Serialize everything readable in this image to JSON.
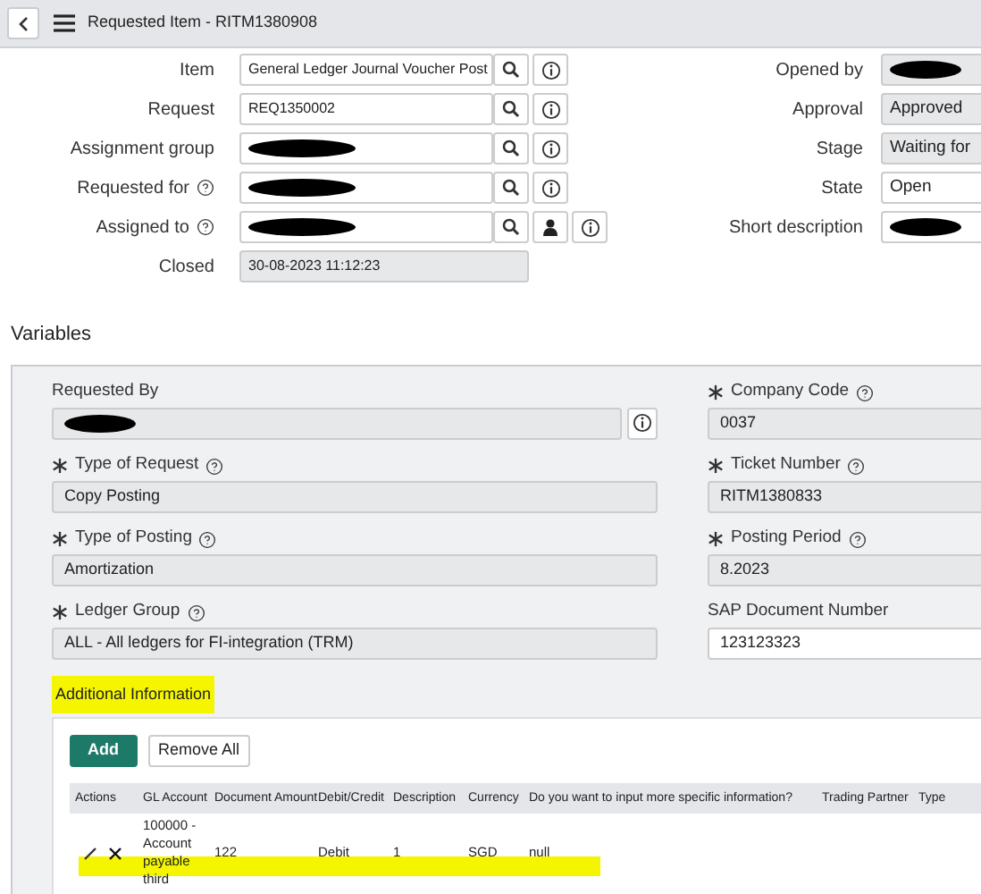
{
  "header": {
    "title": "Requested Item - RITM1380908"
  },
  "form_left": [
    {
      "label": "Item",
      "help": false,
      "value": "General Ledger Journal Voucher Post",
      "redacted": false,
      "readonly": false,
      "search": true,
      "person": false,
      "info": true
    },
    {
      "label": "Request",
      "help": false,
      "value": "REQ1350002",
      "redacted": false,
      "readonly": false,
      "search": true,
      "person": false,
      "info": true
    },
    {
      "label": "Assignment group",
      "help": false,
      "redacted": true,
      "readonly": false,
      "search": true,
      "person": false,
      "info": true
    },
    {
      "label": "Requested for",
      "help": true,
      "redacted": true,
      "readonly": false,
      "search": true,
      "person": false,
      "info": true
    },
    {
      "label": "Assigned to",
      "help": true,
      "redacted": true,
      "readonly": false,
      "search": true,
      "person": true,
      "info": true
    },
    {
      "label": "Closed",
      "help": false,
      "value": "30-08-2023 11:12:23",
      "redacted": false,
      "readonly": true,
      "search": false,
      "person": false,
      "info": false
    }
  ],
  "form_right": [
    {
      "label": "Opened by",
      "redacted": true,
      "readonly": true
    },
    {
      "label": "Approval",
      "value": "Approved",
      "redacted": false,
      "readonly": true
    },
    {
      "label": "Stage",
      "value": "Waiting for",
      "redacted": false,
      "readonly": true
    },
    {
      "label": "State",
      "value": "Open",
      "redacted": false,
      "readonly": false
    },
    {
      "label": "Short description",
      "redacted": true,
      "readonly": false
    }
  ],
  "variables": {
    "title": "Variables",
    "rows": [
      [
        {
          "label": "Requested By",
          "required": false,
          "help": false,
          "redacted": true,
          "readonly": true,
          "info": true
        },
        {
          "label": "Company Code",
          "required": true,
          "help": true,
          "value": "0037",
          "redacted": false,
          "readonly": true,
          "info": false
        }
      ],
      [
        {
          "label": "Type of Request",
          "required": true,
          "help": true,
          "value": "Copy Posting",
          "redacted": false,
          "readonly": true,
          "info": false
        },
        {
          "label": "Ticket Number",
          "required": true,
          "help": true,
          "value": "RITM1380833",
          "redacted": false,
          "readonly": true,
          "info": false
        }
      ],
      [
        {
          "label": "Type of Posting",
          "required": true,
          "help": true,
          "value": "Amortization",
          "redacted": false,
          "readonly": true,
          "info": false
        },
        {
          "label": "Posting Period",
          "required": true,
          "help": true,
          "value": "8.2023",
          "redacted": false,
          "readonly": true,
          "info": false
        }
      ],
      [
        {
          "label": "Ledger Group",
          "required": true,
          "help": true,
          "value": "ALL - All ledgers for FI-integration (TRM)",
          "redacted": false,
          "readonly": true,
          "info": false
        },
        {
          "label": "SAP Document Number",
          "required": false,
          "help": false,
          "value": "123123323",
          "redacted": false,
          "readonly": false,
          "info": false
        }
      ]
    ]
  },
  "additional": {
    "title": "Additional Information",
    "highlighted": true,
    "buttons": [
      {
        "label": "Add",
        "kind": "primary"
      },
      {
        "label": "Remove All",
        "kind": "secondary"
      }
    ],
    "table": {
      "columns": [
        "Actions",
        "GL Account",
        "Document Amount",
        "Debit/Credit",
        "Description",
        "Currency",
        "Do you want to input more specific information?",
        "Trading Partner",
        "Type"
      ],
      "rows": [
        {
          "highlighted": true,
          "cells": [
            "",
            "100000 - Account payable third",
            "122",
            "Debit",
            "1",
            "SGD",
            "null"
          ]
        }
      ]
    }
  }
}
